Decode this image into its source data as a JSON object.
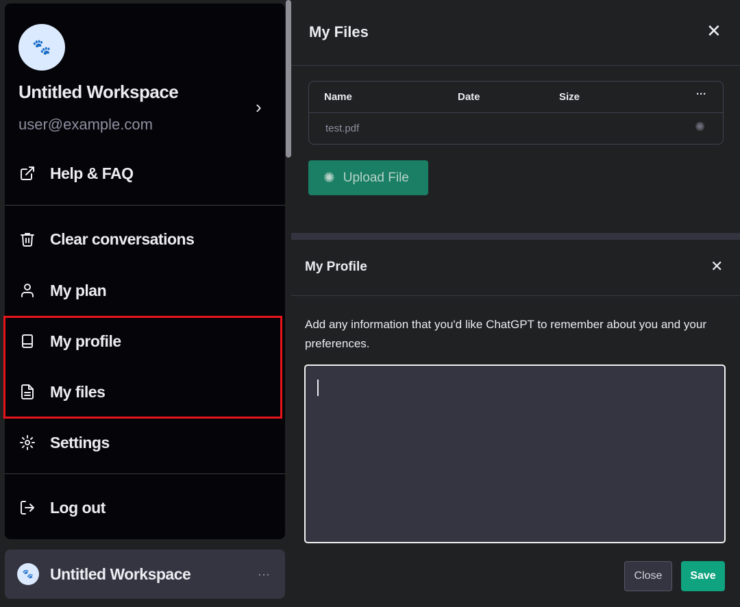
{
  "menu": {
    "workspace_name": "Untitled Workspace",
    "email": "user@example.com",
    "items": [
      {
        "label": "Help & FAQ",
        "icon": "external-link-icon"
      },
      {
        "label": "Clear conversations",
        "icon": "trash-icon"
      },
      {
        "label": "My plan",
        "icon": "user-icon"
      },
      {
        "label": "My profile",
        "icon": "book-icon"
      },
      {
        "label": "My files",
        "icon": "file-text-icon"
      },
      {
        "label": "Settings",
        "icon": "gear-icon"
      },
      {
        "label": "Log out",
        "icon": "logout-icon"
      }
    ]
  },
  "workspace_button": {
    "label": "Untitled Workspace",
    "more": "···"
  },
  "files_panel": {
    "title": "My Files",
    "columns": [
      "Name",
      "Date",
      "Size",
      "···"
    ],
    "rows": [
      {
        "name": "test.pdf",
        "date": "",
        "size": "",
        "status": "loading-spinner"
      }
    ],
    "upload_label": "Upload File"
  },
  "profile_panel": {
    "title": "My Profile",
    "description": "Add any information that you'd like ChatGPT to remember about you and your preferences.",
    "textarea_value": "",
    "close_label": "Close",
    "save_label": "Save"
  },
  "colors": {
    "accent": "#10a37f",
    "highlight": "#e8141b",
    "background": "#202123"
  }
}
